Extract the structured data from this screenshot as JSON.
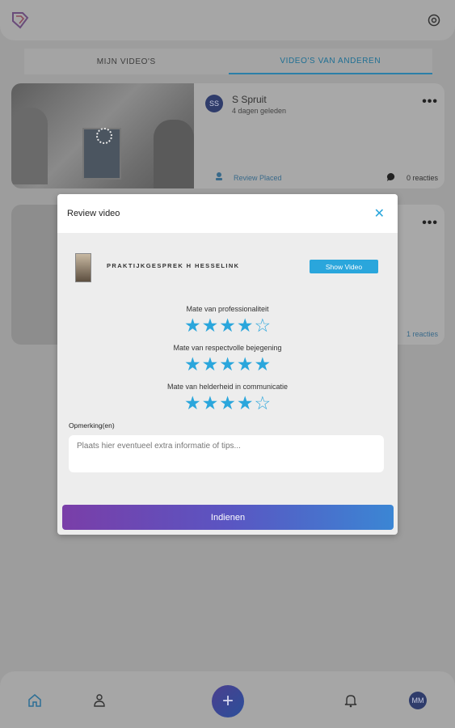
{
  "header": {
    "logo_icon": "app-logo-icon",
    "settings_icon": "settings-icon"
  },
  "tabs": [
    {
      "label": "MIJN VIDEO'S",
      "active": false
    },
    {
      "label": "VIDEO'S VAN ANDEREN",
      "active": true
    }
  ],
  "cards": [
    {
      "avatar_initials": "SS",
      "author": "S Spruit",
      "time_ago": "4 dagen geleden",
      "more_label": "•••",
      "status_label": "Review Placed",
      "comments_label": "0 reacties"
    },
    {
      "more_label": "•••",
      "comments_label": "1 reacties"
    }
  ],
  "modal": {
    "title": "Review video",
    "close_label": "✕",
    "video_title": "PRAKTIJKGESPREK H HESSELINK",
    "show_video_label": "Show Video",
    "questions": [
      {
        "label": "Mate van professionaliteit",
        "rating": 4,
        "max": 5
      },
      {
        "label": "Mate van respectvolle bejegening",
        "rating": 5,
        "max": 5
      },
      {
        "label": "Mate van helderheid in communicatie",
        "rating": 4,
        "max": 5
      }
    ],
    "remarks_label": "Opmerking(en)",
    "remarks_placeholder": "Plaats hier eventueel extra informatie of tips...",
    "remarks_value": "",
    "submit_label": "Indienen"
  },
  "bottom_nav": {
    "items": [
      "home-icon",
      "users-icon",
      "add-icon",
      "bell-icon",
      "profile-avatar"
    ],
    "plus_label": "+",
    "avatar_initials": "MM"
  },
  "colors": {
    "accent": "#2aa6dc",
    "gradient_start": "#7a3ea8",
    "gradient_end": "#3b86d4"
  }
}
